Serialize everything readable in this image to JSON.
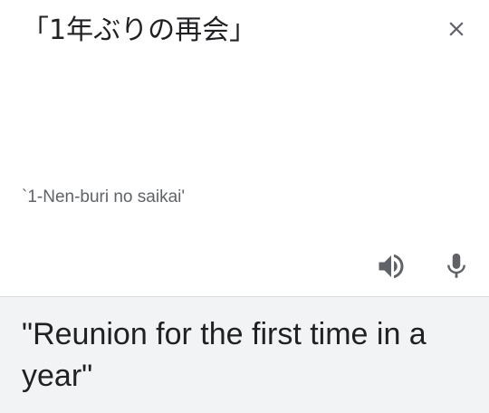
{
  "source": {
    "text": "「1年ぶりの再会」",
    "romanization": "`1-Nen-buri no saikai'"
  },
  "translation": {
    "text": "\"Reunion for the first time in a year\""
  },
  "icons": {
    "close": "close-icon",
    "speaker": "volume-up-icon",
    "mic": "microphone-icon"
  },
  "colors": {
    "icon": "#5f6368",
    "text": "#202124",
    "romanization": "#5f6368",
    "translation_background": "#f1f3f4"
  }
}
